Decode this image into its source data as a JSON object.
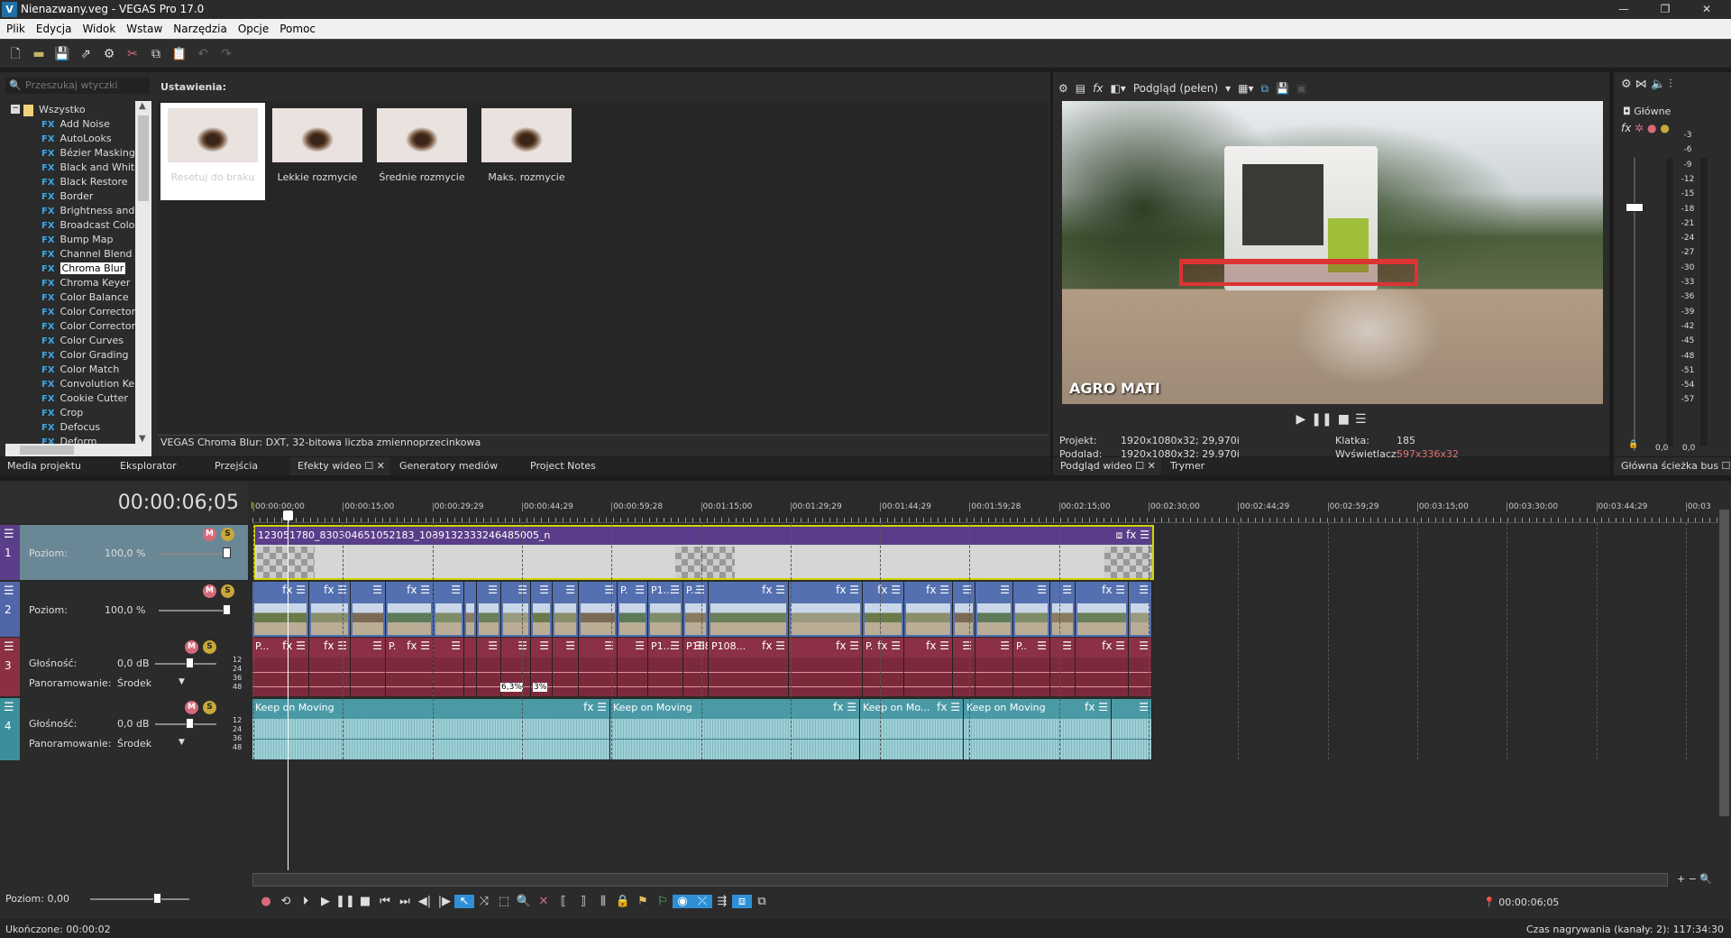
{
  "window": {
    "title": "Nienazwany.veg - VEGAS Pro 17.0",
    "app_icon": "V"
  },
  "menu": [
    "Plik",
    "Edycja",
    "Widok",
    "Wstaw",
    "Narzędzia",
    "Opcje",
    "Pomoc"
  ],
  "plugins": {
    "search_placeholder": "Przeszukaj wtyczki",
    "settings_label": "Ustawienia:",
    "root": "Wszystko",
    "selected": "Chroma Blur",
    "items": [
      "Add Noise",
      "AutoLooks",
      "Bézier Masking",
      "Black and White",
      "Black Restore",
      "Border",
      "Brightness and Co",
      "Broadcast Colors",
      "Bump Map",
      "Channel Blend",
      "Chroma Blur",
      "Chroma Keyer",
      "Color Balance",
      "Color Corrector",
      "Color Corrector (S",
      "Color Curves",
      "Color Grading",
      "Color Match",
      "Convolution Kerne",
      "Cookie Cutter",
      "Crop",
      "Defocus",
      "Deform"
    ],
    "presets": [
      "Resetuj do braku",
      "Lekkie rozmycie",
      "Średnie rozmycie",
      "Maks. rozmycie"
    ],
    "description": "VEGAS Chroma Blur: DXT, 32-bitowa liczba zmiennoprzecinkowa"
  },
  "left_tabs": [
    "Media projektu",
    "Eksplorator",
    "Przejścia",
    "Efekty wideo",
    "Generatory mediów",
    "Project Notes"
  ],
  "preview": {
    "quality": "Podgląd (pełen)",
    "watermark": "AGRO MATI",
    "project_label": "Projekt:",
    "project_value": "1920x1080x32; 29,970i",
    "preview_label": "Podgląd:",
    "preview_value": "1920x1080x32; 29,970i",
    "frame_label": "Klatka:",
    "frame_value": "185",
    "display_label": "Wyświetlacz:",
    "display_value": "597x336x32",
    "display_color": "#e07070",
    "tabs": [
      "Podgląd wideo",
      "Trymer"
    ]
  },
  "mixer": {
    "title": "Główne",
    "scale": [
      "-3",
      "-6",
      "-9",
      "-12",
      "-15",
      "-18",
      "-21",
      "-24",
      "-27",
      "-30",
      "-33",
      "-36",
      "-39",
      "-42",
      "-45",
      "-48",
      "-51",
      "-54",
      "-57"
    ],
    "peak_left": "0,0",
    "peak_right": "0,0",
    "tab": "Główna ścieżka bus"
  },
  "timeline": {
    "timecode": "00:00:06;05",
    "ruler": [
      "00:00:00;00",
      "00:00:15;00",
      "00:00:29;29",
      "00:00:44;29",
      "00:00:59;28",
      "00:01:15;00",
      "00:01:29;29",
      "00:01:44;29",
      "00:01:59;28",
      "00:02:15;00",
      "00:02:30;00",
      "00:02:44;29",
      "00:02:59;29",
      "00:03:15;00",
      "00:03:30;00",
      "00:03:44;29",
      "00:03"
    ],
    "tracks": [
      {
        "number": "1",
        "type": "video",
        "level_label": "Poziom:",
        "level_value": "100,0 %",
        "color": "#5b3e8a"
      },
      {
        "number": "2",
        "type": "video",
        "level_label": "Poziom:",
        "level_value": "100,0 %",
        "color": "#5166a8"
      },
      {
        "number": "3",
        "type": "audio",
        "volume_label": "Głośność:",
        "volume_value": "0,0 dB",
        "pan_label": "Panoramowanie:",
        "pan_value": "Środek",
        "color": "#8a3042"
      },
      {
        "number": "4",
        "type": "audio",
        "volume_label": "Głośność:",
        "volume_value": "0,0 dB",
        "pan_label": "Panoramowanie:",
        "pan_value": "Środek",
        "color": "#3b8f9c"
      }
    ],
    "audio_scale": [
      "12",
      "24",
      "36",
      "48"
    ],
    "overlay_clip": "123051780_830304651052183_1089132333246485005_n",
    "video_clip_labels": [
      "",
      "",
      "",
      "",
      "",
      "",
      "",
      "",
      "",
      "",
      "",
      "P.",
      "P1...",
      "P...",
      "",
      "",
      "",
      "",
      "",
      "",
      "",
      "",
      ""
    ],
    "audio3_clip_labels": [
      "P...",
      "",
      "",
      "P.",
      "",
      "",
      "",
      "",
      "",
      "",
      "",
      "",
      "P1...",
      "P1080...",
      "P108...",
      "",
      "P.",
      "",
      "",
      "",
      "P..",
      "",
      ""
    ],
    "fade_labels": [
      "6,3%",
      "3%"
    ],
    "music_clips": [
      "Keep on Moving",
      "Keep on Moving",
      "Keep on Mo...",
      "Keep on Moving",
      ""
    ]
  },
  "bottom": {
    "level": "Poziom: 0,00",
    "cursor_time": "00:00:06;05",
    "status_left": "Ukończone: 00:00:02",
    "status_right": "Czas nagrywania (kanały: 2): 117:34:30"
  }
}
